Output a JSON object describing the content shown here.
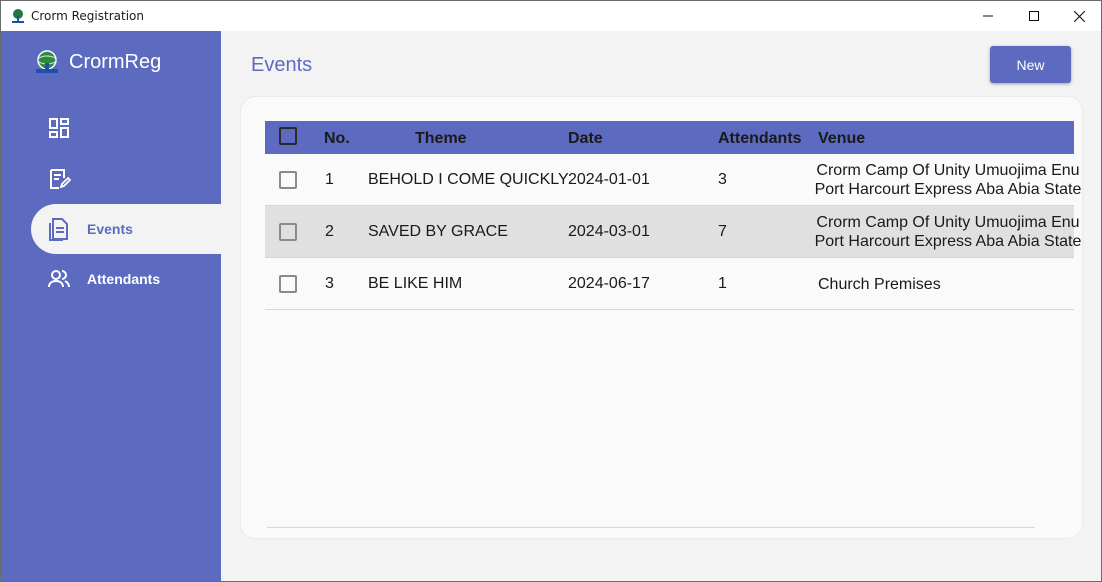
{
  "window": {
    "title": "Crorm Registration"
  },
  "sidebar": {
    "brand": "CrormReg",
    "items": [
      {
        "label": "",
        "icon": "dashboard-icon"
      },
      {
        "label": "",
        "icon": "edit-note-icon"
      },
      {
        "label": "Events",
        "icon": "document-icon",
        "active": true
      },
      {
        "label": "Attendants",
        "icon": "people-icon"
      }
    ]
  },
  "main": {
    "title": "Events",
    "new_label": "New"
  },
  "table": {
    "columns": [
      "No.",
      "Theme",
      "Date",
      "Attendants",
      "Venue"
    ],
    "rows": [
      {
        "no": "1",
        "theme": "BEHOLD I COME QUICKLY",
        "date": "2024-01-01",
        "attendants": "3",
        "venue_line1": "Crorm Camp Of Unity Umuojima Enu",
        "venue_line2": "Port Harcourt Express Aba Abia State"
      },
      {
        "no": "2",
        "theme": "SAVED BY GRACE",
        "date": "2024-03-01",
        "attendants": "7",
        "venue_line1": "Crorm Camp Of Unity Umuojima Enu",
        "venue_line2": "Port Harcourt Express Aba Abia State"
      },
      {
        "no": "3",
        "theme": "BE LIKE HIM",
        "date": "2024-06-17",
        "attendants": "1",
        "venue_line1": "Church Premises",
        "venue_line2": ""
      }
    ]
  },
  "colors": {
    "accent": "#5c6bc0",
    "background": "#f3f3f3",
    "card": "#fafafa",
    "row_alt": "#e0e0e0"
  }
}
